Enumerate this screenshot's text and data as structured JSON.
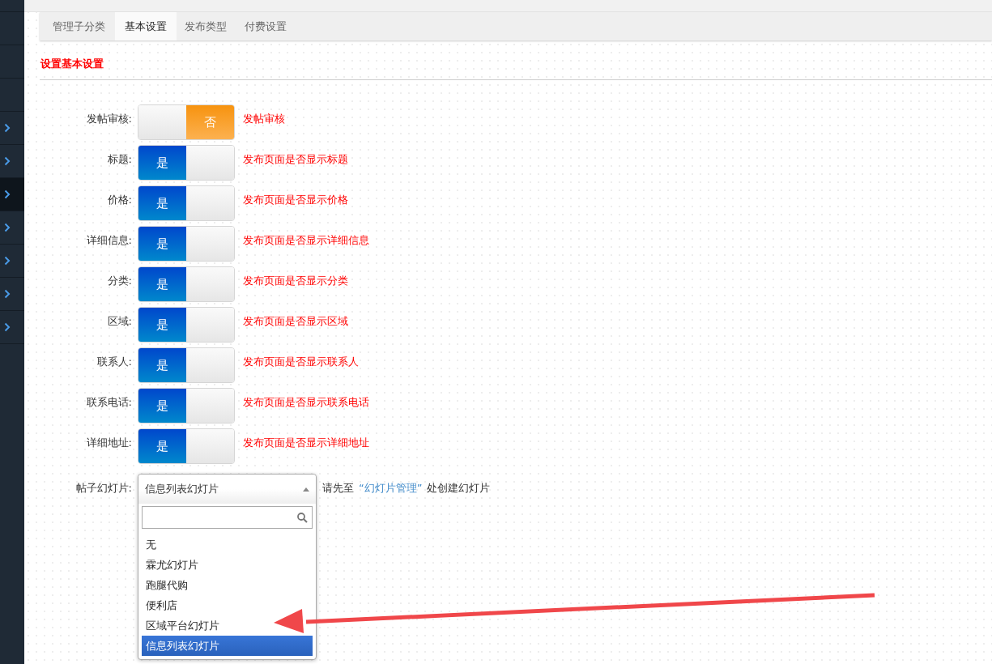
{
  "sidebar": {
    "items": [
      {
        "kind": "blank",
        "selected": false
      },
      {
        "kind": "blank",
        "selected": false
      },
      {
        "kind": "blank",
        "selected": false
      },
      {
        "kind": "chevron",
        "selected": false
      },
      {
        "kind": "chevron",
        "selected": false
      },
      {
        "kind": "chevron",
        "selected": true
      },
      {
        "kind": "chevron",
        "selected": false
      },
      {
        "kind": "chevron",
        "selected": false
      },
      {
        "kind": "chevron",
        "selected": false
      },
      {
        "kind": "chevron",
        "selected": false
      }
    ]
  },
  "tabs": [
    {
      "label": "管理子分类",
      "selected": false
    },
    {
      "label": "基本设置",
      "selected": true
    },
    {
      "label": "发布类型",
      "selected": false
    },
    {
      "label": "付费设置",
      "selected": false
    }
  ],
  "section_title": "设置基本设置",
  "settings": [
    {
      "label": "发帖审核:",
      "on": false,
      "state_text": "否",
      "description": "发帖审核"
    },
    {
      "label": "标题:",
      "on": true,
      "state_text": "是",
      "description": "发布页面是否显示标题"
    },
    {
      "label": "价格:",
      "on": true,
      "state_text": "是",
      "description": "发布页面是否显示价格"
    },
    {
      "label": "详细信息:",
      "on": true,
      "state_text": "是",
      "description": "发布页面是否显示详细信息"
    },
    {
      "label": "分类:",
      "on": true,
      "state_text": "是",
      "description": "发布页面是否显示分类"
    },
    {
      "label": "区域:",
      "on": true,
      "state_text": "是",
      "description": "发布页面是否显示区域"
    },
    {
      "label": "联系人:",
      "on": true,
      "state_text": "是",
      "description": "发布页面是否显示联系人"
    },
    {
      "label": "联系电话:",
      "on": true,
      "state_text": "是",
      "description": "发布页面是否显示联系电话"
    },
    {
      "label": "详细地址:",
      "on": true,
      "state_text": "是",
      "description": "发布页面是否显示详细地址"
    }
  ],
  "slideshow": {
    "label": "帖子幻灯片:",
    "value": "信息列表幻灯片",
    "expanded": true,
    "hint_before": "请先至",
    "hint_link": "“幻灯片管理”",
    "hint_after": "处创建幻灯片",
    "options": [
      {
        "label": "无",
        "selected": false
      },
      {
        "label": "霖尤幻灯片",
        "selected": false
      },
      {
        "label": "跑腿代购",
        "selected": false
      },
      {
        "label": "便利店",
        "selected": false
      },
      {
        "label": "区域平台幻灯片",
        "selected": false
      },
      {
        "label": "信息列表幻灯片",
        "selected": true
      }
    ]
  }
}
